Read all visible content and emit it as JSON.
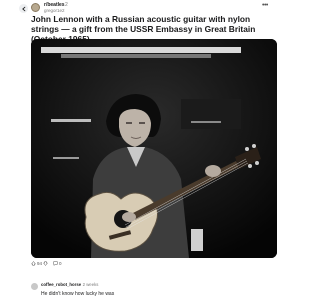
{
  "post": {
    "subreddit": "r/beatles",
    "time_sep": "· 2",
    "author": "gregor1e2",
    "more": "•••",
    "title": "John Lennon with a Russian acoustic guitar with nylon strings — a gift from the USSR Embassy in Great Britain (October 1965)"
  },
  "actions": {
    "upvotes": "94",
    "comments": "0"
  },
  "comment": {
    "author": "coffee_robot_horse",
    "time": "· 2 weeks",
    "text": "He didn't know how lucky he was"
  },
  "colors": {
    "photo_bg": "#060606",
    "text": "#1a1a1b",
    "muted": "#7c7c7c"
  }
}
